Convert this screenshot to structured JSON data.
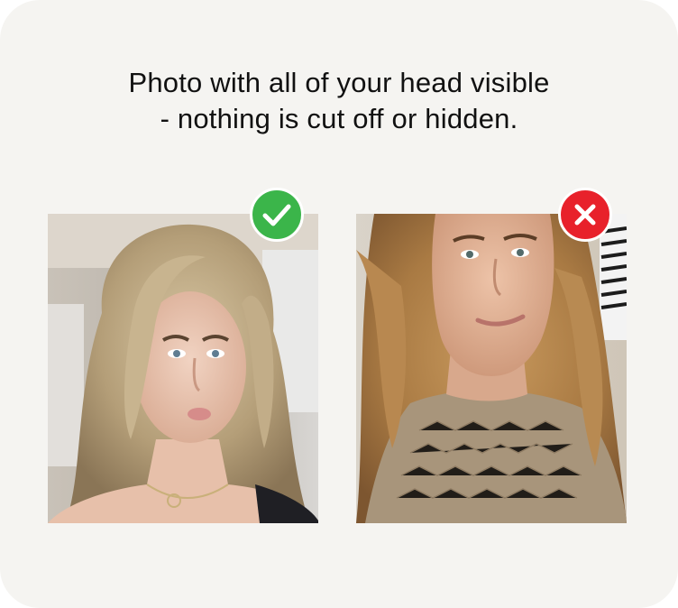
{
  "instruction": {
    "line1": "Photo with all of your head visible",
    "line2": "- nothing is cut off or hidden."
  },
  "examples": [
    {
      "verdict": "correct",
      "icon": "check-icon",
      "badge_color": "#3bb54a"
    },
    {
      "verdict": "incorrect",
      "icon": "cross-icon",
      "badge_color": "#e8212b"
    }
  ],
  "colors": {
    "card_background": "#f5f4f1",
    "text": "#111111"
  }
}
